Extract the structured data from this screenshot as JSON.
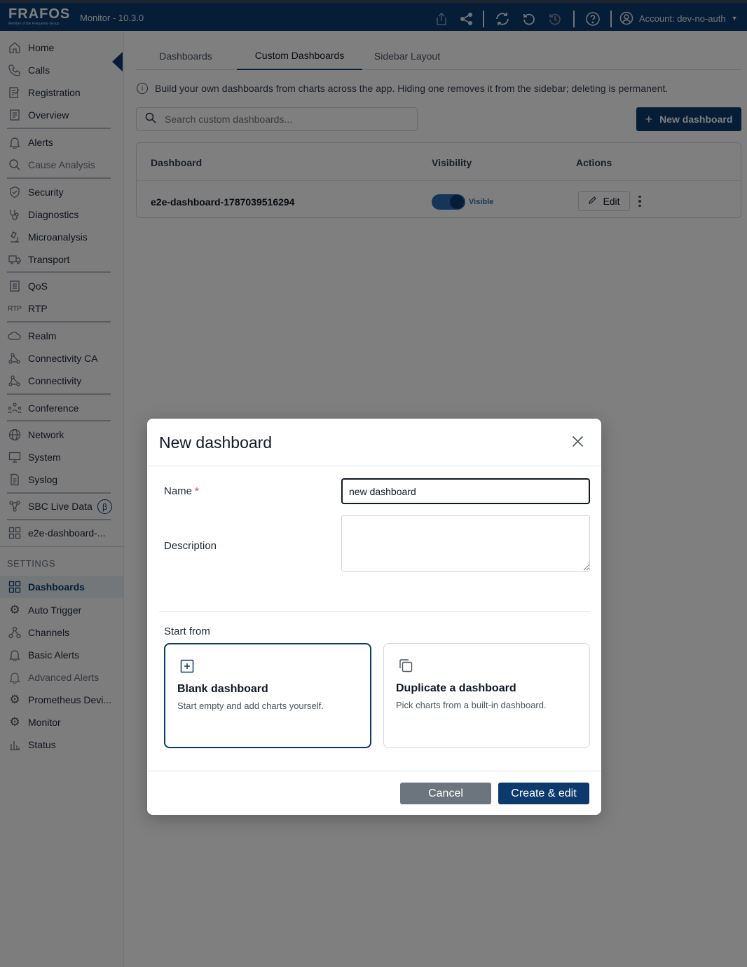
{
  "header": {
    "logo_text": "FRAFOS",
    "logo_tagline": "Member of the Frequentis Group",
    "app_title": "Monitor - 10.3.0",
    "account_label": "Account: dev-no-auth"
  },
  "sidebar": {
    "items": [
      {
        "label": "Home",
        "icon": "home-icon"
      },
      {
        "label": "Calls",
        "icon": "phone-icon"
      },
      {
        "label": "Registration",
        "icon": "registration-icon"
      },
      {
        "label": "Overview",
        "icon": "overview-icon"
      },
      {
        "label": "Alerts",
        "icon": "alerts-icon"
      },
      {
        "label": "Cause Analysis",
        "icon": "search-icon"
      },
      {
        "label": "Security",
        "icon": "shield-icon"
      },
      {
        "label": "Diagnostics",
        "icon": "stethoscope-icon"
      },
      {
        "label": "Microanalysis",
        "icon": "microscope-icon"
      },
      {
        "label": "Transport",
        "icon": "truck-icon"
      },
      {
        "label": "QoS",
        "icon": "qos-icon"
      },
      {
        "label": "RTP",
        "icon": "rtp-icon"
      },
      {
        "label": "Realm",
        "icon": "cloud-icon"
      },
      {
        "label": "Connectivity CA",
        "icon": "connectivity-icon"
      },
      {
        "label": "Connectivity",
        "icon": "connectivity-icon"
      },
      {
        "label": "Conference",
        "icon": "people-icon"
      },
      {
        "label": "Network",
        "icon": "globe-icon"
      },
      {
        "label": "System",
        "icon": "monitor-icon"
      },
      {
        "label": "Syslog",
        "icon": "document-icon"
      },
      {
        "label": "SBC Live Data",
        "icon": "nodes-icon",
        "badge": "β"
      },
      {
        "label": "e2e-dashboard-...",
        "icon": "grid-icon"
      }
    ],
    "settings_label": "SETTINGS",
    "settings_items": [
      {
        "label": "Dashboards",
        "icon": "grid-icon"
      },
      {
        "label": "Auto Trigger",
        "icon": "gear-icon"
      },
      {
        "label": "Channels",
        "icon": "channels-icon"
      },
      {
        "label": "Basic Alerts",
        "icon": "bell-icon"
      },
      {
        "label": "Advanced Alerts",
        "icon": "bell-icon"
      },
      {
        "label": "Prometheus Devi...",
        "icon": "gear-icon"
      },
      {
        "label": "Monitor",
        "icon": "gear-icon"
      },
      {
        "label": "Status",
        "icon": "bar-chart-icon"
      }
    ]
  },
  "tabs": [
    "Dashboards",
    "Custom Dashboards",
    "Sidebar Layout"
  ],
  "info_text": "Build your own dashboards from charts across the app. Hiding one removes it from the sidebar; deleting is permanent.",
  "search": {
    "placeholder": "Search custom dashboards..."
  },
  "new_button_label": "New dashboard",
  "table": {
    "headers": [
      "Dashboard",
      "Visibility",
      "Actions"
    ],
    "rows": [
      {
        "name": "e2e-dashboard-1787039516294",
        "visibility": "Visible",
        "edit_label": "Edit"
      }
    ]
  },
  "modal": {
    "title": "New dashboard",
    "name_label": "Name",
    "required_mark": "*",
    "name_value": "new dashboard",
    "description_label": "Description",
    "description_value": "",
    "start_from_label": "Start from",
    "options": [
      {
        "title": "Blank dashboard",
        "description": "Start empty and add charts yourself."
      },
      {
        "title": "Duplicate a dashboard",
        "description": "Pick charts from a built-in dashboard."
      }
    ],
    "cancel_label": "Cancel",
    "create_label": "Create & edit"
  },
  "colors": {
    "brand": "#0d3a6e",
    "toggle_on": "#2e6ab0",
    "cancel": "#6c757d",
    "required": "#dc3545"
  }
}
